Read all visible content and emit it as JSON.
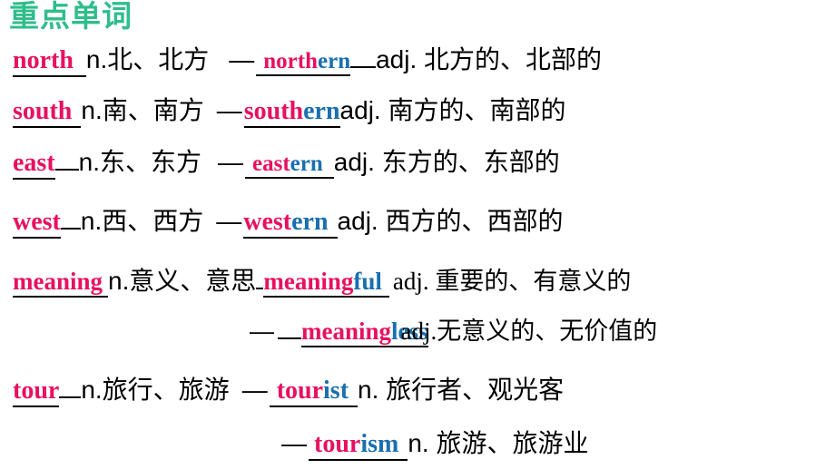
{
  "slide": {
    "title": "重点单词",
    "title_color": "#2FBD8B",
    "root_color": "#E8105F",
    "suffix_color": "#1A6FAF",
    "text_color": "#000000",
    "background_color": "#FFFFFF"
  },
  "entries": [
    {
      "id": "north",
      "base_word": "north",
      "base_pos": "n.",
      "base_gloss": "北、北方",
      "base_line": "n.北、北方",
      "connector": "—",
      "derived_root": "north",
      "derived_suffix": "ern",
      "derived_word": "northern",
      "derived_pos": "adj.",
      "derived_gloss": "北方的、北部的",
      "derived_line": "adj. 北方的、北部的"
    },
    {
      "id": "south",
      "base_word": "south",
      "base_pos": "n.",
      "base_gloss": "南、南方",
      "base_line": "n.南、南方",
      "connector": "—",
      "derived_root": "south",
      "derived_suffix": "ern",
      "derived_word": "southern",
      "derived_pos": "adj.",
      "derived_gloss": "南方的、南部的",
      "derived_line": "adj. 南方的、南部的"
    },
    {
      "id": "east",
      "base_word": "east",
      "base_pos": "n.",
      "base_gloss": "东、东方",
      "base_line": "n.东、东方",
      "connector": "—",
      "derived_root": "east",
      "derived_suffix": "ern",
      "derived_word": "eastern",
      "derived_pos": "adj.",
      "derived_gloss": "东方的、东部的",
      "derived_line": "adj. 东方的、东部的"
    },
    {
      "id": "west",
      "base_word": "west",
      "base_pos": "n.",
      "base_gloss": "西、西方",
      "base_line": "n.西、西方",
      "connector": "—",
      "derived_root": "west",
      "derived_suffix": "ern",
      "derived_word": "western",
      "derived_pos": "adj.",
      "derived_gloss": "西方的、西部的",
      "derived_line": "adj. 西方的、西部的"
    },
    {
      "id": "meaning",
      "base_word": "meaning",
      "base_pos": "n.",
      "base_gloss": "意义、意思",
      "base_line": "n.意义、意思",
      "connector": "",
      "derived_root": "meaning",
      "derived_suffix": "ful",
      "derived_word": "meaningful",
      "derived_pos": "adj.",
      "derived_gloss": "重要的、有意义的",
      "derived_line": "adj. 重要的、有意义的"
    },
    {
      "id": "meaningless",
      "base_word": "",
      "base_pos": "",
      "base_gloss": "",
      "base_line": "",
      "connector": "—",
      "derived_root": "meaning",
      "derived_suffix": "less",
      "derived_word": "meaningless",
      "derived_pos": "adj.",
      "derived_gloss": "无意义的、无价值的",
      "derived_line": "adj.无意义的、无价值的"
    },
    {
      "id": "tour",
      "base_word": "tour",
      "base_pos": "n.",
      "base_gloss": "旅行、旅游",
      "base_line": "n.旅行、旅游",
      "connector": "—",
      "derived_root": "tour",
      "derived_suffix": "ist",
      "derived_word": "tourist",
      "derived_pos": "n.",
      "derived_gloss": "旅行者、观光客",
      "derived_line": "n. 旅行者、观光客"
    },
    {
      "id": "tourism",
      "base_word": "",
      "base_pos": "",
      "base_gloss": "",
      "base_line": "",
      "connector": "—",
      "derived_root": "tour",
      "derived_suffix": "ism",
      "derived_word": "tourism",
      "derived_pos": "n.",
      "derived_gloss": "旅游、旅游业",
      "derived_line": "n. 旅游、旅游业"
    }
  ]
}
